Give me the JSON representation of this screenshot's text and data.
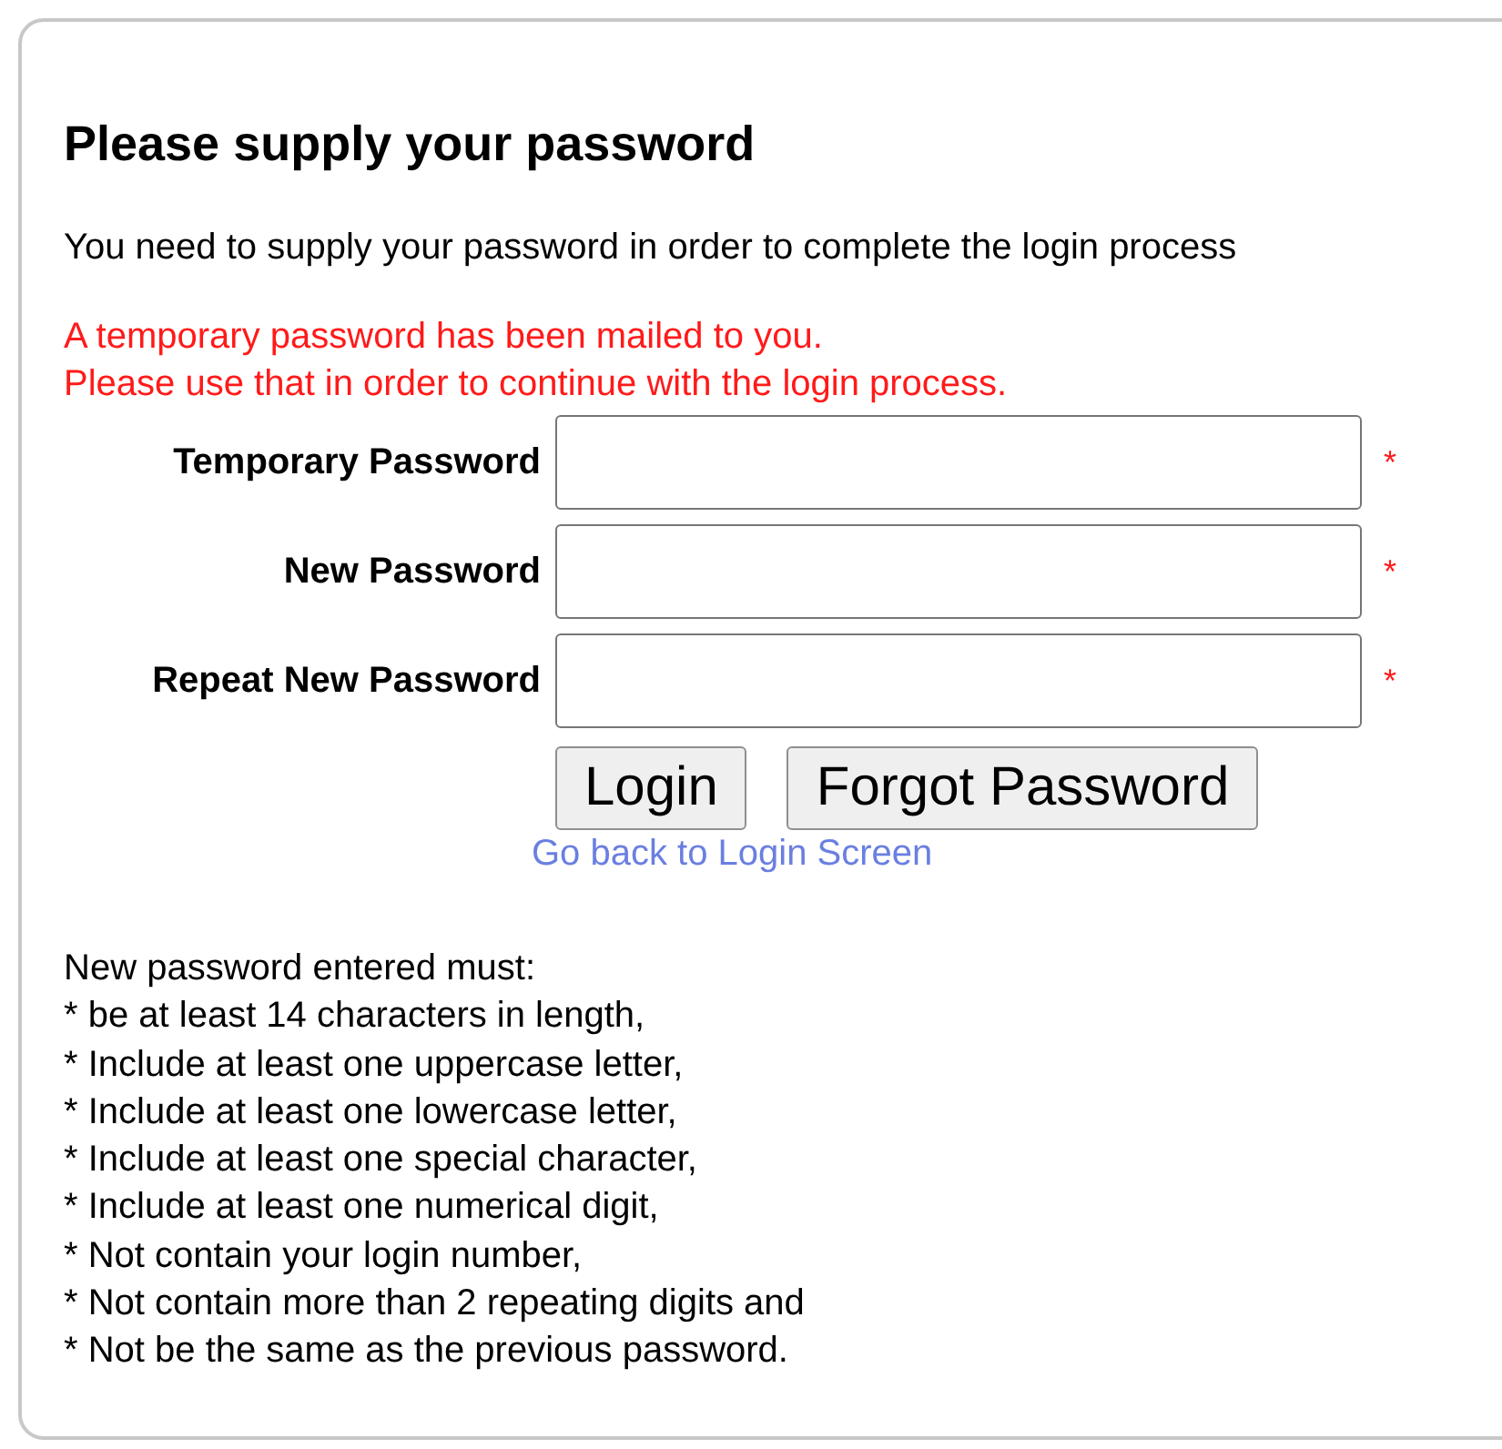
{
  "title": "Please supply your password",
  "intro": "You need to supply your password in order to complete the login process",
  "notice": [
    "A temporary password has been mailed to you.",
    "Please use that in order to continue with the login process."
  ],
  "fields": [
    {
      "label": "Temporary Password",
      "required_mark": "*"
    },
    {
      "label": "New Password",
      "required_mark": "*"
    },
    {
      "label": "Repeat New Password",
      "required_mark": "*"
    }
  ],
  "buttons": [
    "Login",
    "Forgot Password"
  ],
  "link": "Go back to Login Screen",
  "requirements": {
    "heading": "New password entered must:",
    "items": [
      "* be at least 14 characters in length,",
      "* Include at least one uppercase letter,",
      "* Include at least one lowercase letter,",
      "* Include at least one special character,",
      "* Include at least one numerical digit,",
      "* Not contain your login number,",
      "* Not contain more than 2 repeating digits and",
      "* Not be the same as the previous password."
    ]
  }
}
